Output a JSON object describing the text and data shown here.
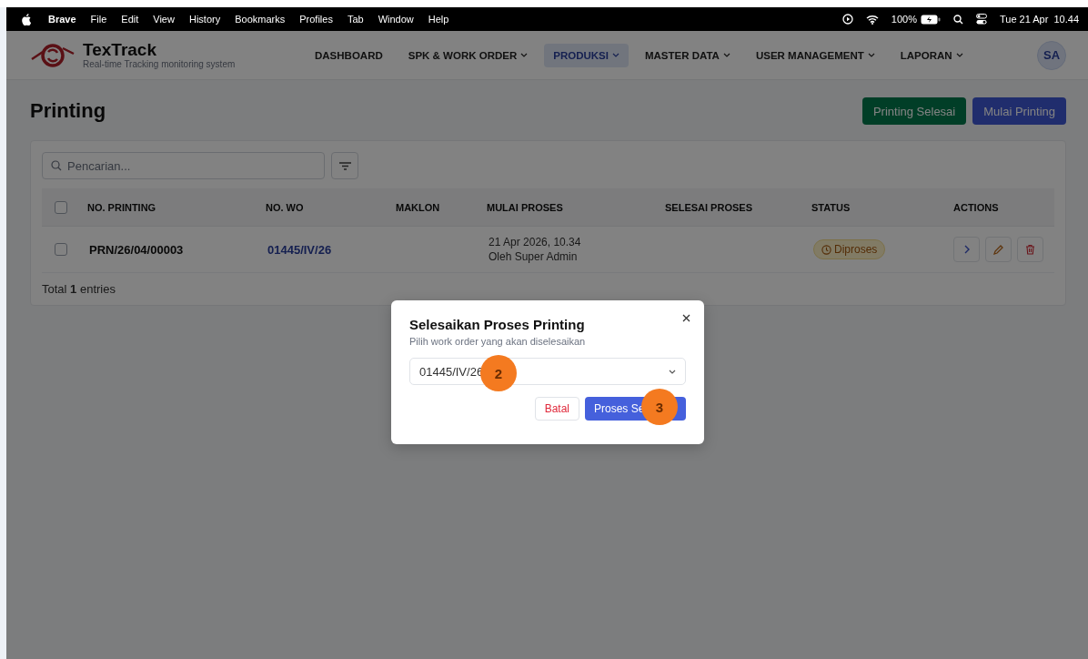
{
  "menu_bar": {
    "app": "Brave",
    "menus": [
      "File",
      "Edit",
      "View",
      "History",
      "Bookmarks",
      "Profiles",
      "Tab",
      "Window",
      "Help"
    ],
    "battery": "100%",
    "clock": "Tue 21 Apr  10.44"
  },
  "header": {
    "brand": "TexTrack",
    "tagline": "Real-time Tracking monitoring system",
    "avatar": "SA",
    "nav": [
      {
        "label": "DASHBOARD",
        "selected": false,
        "dropdown": false
      },
      {
        "label": "SPK & WORK ORDER",
        "selected": false,
        "dropdown": true
      },
      {
        "label": "PRODUKSI",
        "selected": true,
        "dropdown": true
      },
      {
        "label": "MASTER DATA",
        "selected": false,
        "dropdown": true
      },
      {
        "label": "USER MANAGEMENT",
        "selected": false,
        "dropdown": true
      },
      {
        "label": "LAPORAN",
        "selected": false,
        "dropdown": true
      }
    ]
  },
  "page": {
    "title": "Printing",
    "buttons": [
      {
        "label": "Printing Selesai",
        "kind": "success"
      },
      {
        "label": "Mulai Printing",
        "kind": "primary"
      }
    ]
  },
  "search": {
    "placeholder": "Pencarian..."
  },
  "table": {
    "select_all_checked": false,
    "columns": [
      "NO. PRINTING",
      "NO. WO",
      "MAKLON",
      "MULAI PROSES",
      "SELESAI PROSES",
      "STATUS",
      "ACTIONS"
    ],
    "rows": [
      {
        "checked": false,
        "no_printing": "PRN/26/04/00003",
        "no_wo": "01445/IV/26",
        "mulai_proses": "21 Apr 2026, 10.34",
        "mulai_oleh": "Oleh Super Admin",
        "status": "Diproses"
      }
    ],
    "footer": "Total **1** entries"
  },
  "modal": {
    "title": "Selesaikan Proses Printing",
    "subtitle": "Pilih work order yang akan diselesaikan",
    "select_value": "01445/IV/26",
    "buttons": [
      {
        "label": "Batal",
        "kind": "cancel"
      },
      {
        "label": "Proses Se",
        "kind": "confirm"
      }
    ]
  },
  "callouts": [
    {
      "label": "2"
    },
    {
      "label": "3"
    }
  ]
}
